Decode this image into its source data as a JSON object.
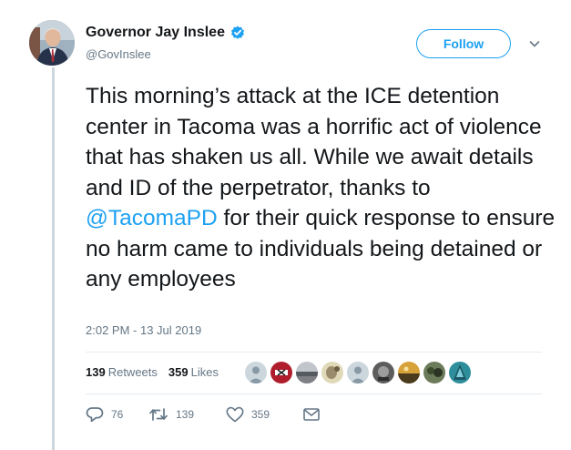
{
  "author": {
    "name": "Governor Jay Inslee",
    "handle": "@GovInslee",
    "verified": true
  },
  "follow_button": {
    "label": "Follow"
  },
  "tweet": {
    "text_before": "This morning’s attack at the ICE detention center in Tacoma was a horrific act of violence that has shaken us all. While we await details and ID of the perpetrator, thanks to ",
    "mention": "@TacomaPD",
    "text_after": " for their quick response to ensure no harm came to individuals being detained or any employees",
    "timestamp": "2:02 PM - 13 Jul 2019"
  },
  "stats": {
    "retweets_count": "139",
    "retweets_label": "Retweets",
    "likes_count": "359",
    "likes_label": "Likes"
  },
  "actions": {
    "reply_count": "76",
    "retweet_count": "139",
    "like_count": "359"
  },
  "colors": {
    "accent": "#1da1f2",
    "text": "#14171a",
    "secondary_text": "#657786",
    "border": "#e6ecf0"
  },
  "icons": [
    "verified-badge-icon",
    "chevron-down-icon",
    "reply-icon",
    "retweet-icon",
    "heart-icon",
    "direct-message-icon"
  ]
}
